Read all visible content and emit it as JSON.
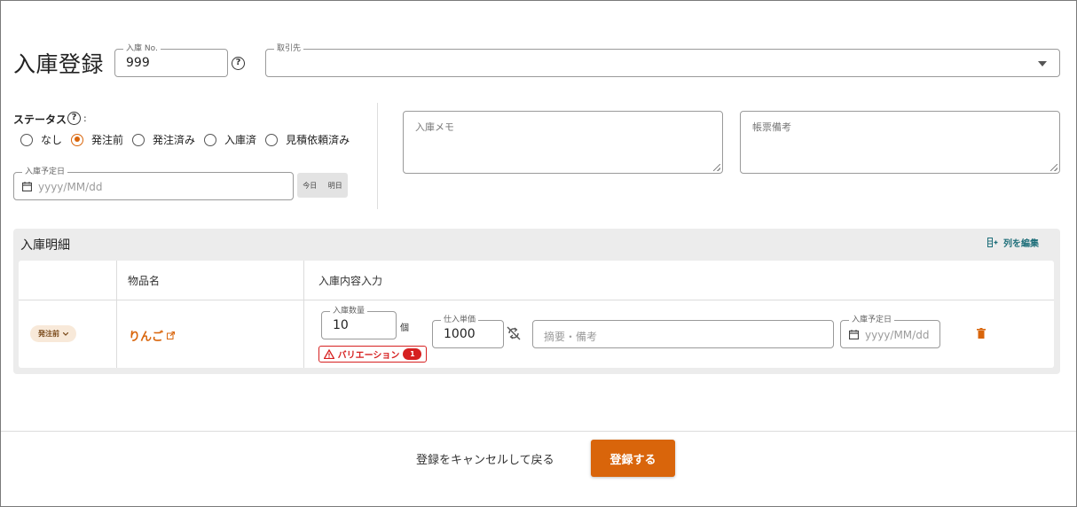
{
  "page": {
    "title": "入庫登録"
  },
  "header": {
    "receipt_no": {
      "label": "入庫 No.",
      "value": "999"
    },
    "supplier": {
      "label": "取引先",
      "value": ""
    }
  },
  "status": {
    "label": "ステータス",
    "colon": ":",
    "options": [
      "なし",
      "発注前",
      "発注済み",
      "入庫済",
      "見積依頼済み"
    ],
    "selected": "発注前"
  },
  "scheduled_date": {
    "label": "入庫予定日",
    "placeholder": "yyyy/MM/dd",
    "today": "今日",
    "tomorrow": "明日"
  },
  "memo": {
    "label": "入庫メモ"
  },
  "remarks": {
    "label": "帳票備考"
  },
  "details": {
    "title": "入庫明細",
    "edit_columns": "列を編集",
    "columns": [
      "",
      "物品名",
      "入庫内容入力"
    ],
    "rows": [
      {
        "status_chip": "発注前",
        "item_name": "りんご",
        "quantity": {
          "label": "入庫数量",
          "value": "10",
          "unit": "個"
        },
        "unit_price": {
          "label": "仕入単価",
          "value": "1000"
        },
        "summary": {
          "placeholder": "摘要・備考"
        },
        "date": {
          "label": "入庫予定日",
          "placeholder": "yyyy/MM/dd"
        },
        "variation": {
          "label": "バリエーション",
          "count": "1"
        }
      }
    ]
  },
  "footer": {
    "cancel": "登録をキャンセルして戻る",
    "submit": "登録する"
  },
  "colors": {
    "accent": "#d9650b",
    "danger": "#d62020",
    "teal": "#1f6f7a"
  }
}
